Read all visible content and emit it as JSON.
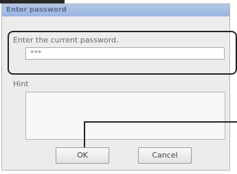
{
  "dialog": {
    "title": "Enter password",
    "current_password_label": "Enter the current password.",
    "password_value": "***",
    "hint_label": "Hint",
    "hint_value": "",
    "buttons": {
      "ok": "OK",
      "cancel": "Cancel"
    }
  }
}
